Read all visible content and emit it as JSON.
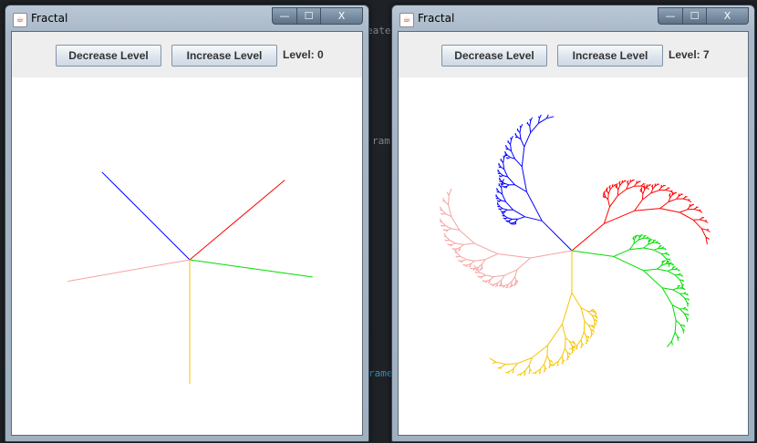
{
  "background_code": [
    "eate",
    "ram",
    "rame"
  ],
  "windows": [
    {
      "title": "Fractal",
      "decrease_label": "Decrease Level",
      "increase_label": "Increase Level",
      "level_text": "Level: 0",
      "level": 0
    },
    {
      "title": "Fractal",
      "decrease_label": "Decrease Level",
      "increase_label": "Increase Level",
      "level_text": "Level: 7",
      "level": 7
    }
  ],
  "window_controls": {
    "minimize": "—",
    "maximize": "☐",
    "close": "X"
  },
  "colors": {
    "branch_1": "#0000ff",
    "branch_2": "#ff0000",
    "branch_3": "#00dd00",
    "branch_4": "#f5c400",
    "branch_5": "#f4a3a3"
  }
}
